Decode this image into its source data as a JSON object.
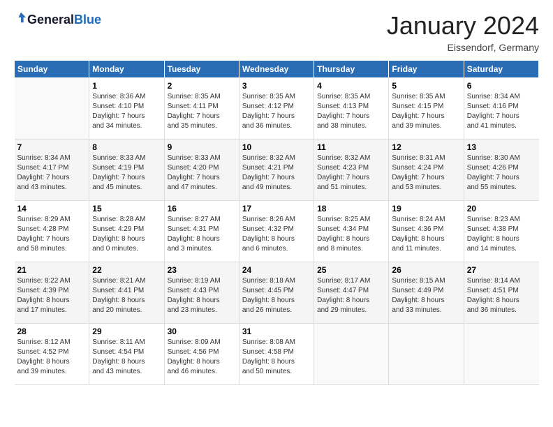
{
  "header": {
    "logo": {
      "general": "General",
      "blue": "Blue"
    },
    "title": "January 2024",
    "location": "Eissendorf, Germany"
  },
  "weekdays": [
    "Sunday",
    "Monday",
    "Tuesday",
    "Wednesday",
    "Thursday",
    "Friday",
    "Saturday"
  ],
  "weeks": [
    [
      {
        "day": "",
        "info": ""
      },
      {
        "day": "1",
        "info": "Sunrise: 8:36 AM\nSunset: 4:10 PM\nDaylight: 7 hours\nand 34 minutes."
      },
      {
        "day": "2",
        "info": "Sunrise: 8:35 AM\nSunset: 4:11 PM\nDaylight: 7 hours\nand 35 minutes."
      },
      {
        "day": "3",
        "info": "Sunrise: 8:35 AM\nSunset: 4:12 PM\nDaylight: 7 hours\nand 36 minutes."
      },
      {
        "day": "4",
        "info": "Sunrise: 8:35 AM\nSunset: 4:13 PM\nDaylight: 7 hours\nand 38 minutes."
      },
      {
        "day": "5",
        "info": "Sunrise: 8:35 AM\nSunset: 4:15 PM\nDaylight: 7 hours\nand 39 minutes."
      },
      {
        "day": "6",
        "info": "Sunrise: 8:34 AM\nSunset: 4:16 PM\nDaylight: 7 hours\nand 41 minutes."
      }
    ],
    [
      {
        "day": "7",
        "info": "Sunrise: 8:34 AM\nSunset: 4:17 PM\nDaylight: 7 hours\nand 43 minutes."
      },
      {
        "day": "8",
        "info": "Sunrise: 8:33 AM\nSunset: 4:19 PM\nDaylight: 7 hours\nand 45 minutes."
      },
      {
        "day": "9",
        "info": "Sunrise: 8:33 AM\nSunset: 4:20 PM\nDaylight: 7 hours\nand 47 minutes."
      },
      {
        "day": "10",
        "info": "Sunrise: 8:32 AM\nSunset: 4:21 PM\nDaylight: 7 hours\nand 49 minutes."
      },
      {
        "day": "11",
        "info": "Sunrise: 8:32 AM\nSunset: 4:23 PM\nDaylight: 7 hours\nand 51 minutes."
      },
      {
        "day": "12",
        "info": "Sunrise: 8:31 AM\nSunset: 4:24 PM\nDaylight: 7 hours\nand 53 minutes."
      },
      {
        "day": "13",
        "info": "Sunrise: 8:30 AM\nSunset: 4:26 PM\nDaylight: 7 hours\nand 55 minutes."
      }
    ],
    [
      {
        "day": "14",
        "info": "Sunrise: 8:29 AM\nSunset: 4:28 PM\nDaylight: 7 hours\nand 58 minutes."
      },
      {
        "day": "15",
        "info": "Sunrise: 8:28 AM\nSunset: 4:29 PM\nDaylight: 8 hours\nand 0 minutes."
      },
      {
        "day": "16",
        "info": "Sunrise: 8:27 AM\nSunset: 4:31 PM\nDaylight: 8 hours\nand 3 minutes."
      },
      {
        "day": "17",
        "info": "Sunrise: 8:26 AM\nSunset: 4:32 PM\nDaylight: 8 hours\nand 6 minutes."
      },
      {
        "day": "18",
        "info": "Sunrise: 8:25 AM\nSunset: 4:34 PM\nDaylight: 8 hours\nand 8 minutes."
      },
      {
        "day": "19",
        "info": "Sunrise: 8:24 AM\nSunset: 4:36 PM\nDaylight: 8 hours\nand 11 minutes."
      },
      {
        "day": "20",
        "info": "Sunrise: 8:23 AM\nSunset: 4:38 PM\nDaylight: 8 hours\nand 14 minutes."
      }
    ],
    [
      {
        "day": "21",
        "info": "Sunrise: 8:22 AM\nSunset: 4:39 PM\nDaylight: 8 hours\nand 17 minutes."
      },
      {
        "day": "22",
        "info": "Sunrise: 8:21 AM\nSunset: 4:41 PM\nDaylight: 8 hours\nand 20 minutes."
      },
      {
        "day": "23",
        "info": "Sunrise: 8:19 AM\nSunset: 4:43 PM\nDaylight: 8 hours\nand 23 minutes."
      },
      {
        "day": "24",
        "info": "Sunrise: 8:18 AM\nSunset: 4:45 PM\nDaylight: 8 hours\nand 26 minutes."
      },
      {
        "day": "25",
        "info": "Sunrise: 8:17 AM\nSunset: 4:47 PM\nDaylight: 8 hours\nand 29 minutes."
      },
      {
        "day": "26",
        "info": "Sunrise: 8:15 AM\nSunset: 4:49 PM\nDaylight: 8 hours\nand 33 minutes."
      },
      {
        "day": "27",
        "info": "Sunrise: 8:14 AM\nSunset: 4:51 PM\nDaylight: 8 hours\nand 36 minutes."
      }
    ],
    [
      {
        "day": "28",
        "info": "Sunrise: 8:12 AM\nSunset: 4:52 PM\nDaylight: 8 hours\nand 39 minutes."
      },
      {
        "day": "29",
        "info": "Sunrise: 8:11 AM\nSunset: 4:54 PM\nDaylight: 8 hours\nand 43 minutes."
      },
      {
        "day": "30",
        "info": "Sunrise: 8:09 AM\nSunset: 4:56 PM\nDaylight: 8 hours\nand 46 minutes."
      },
      {
        "day": "31",
        "info": "Sunrise: 8:08 AM\nSunset: 4:58 PM\nDaylight: 8 hours\nand 50 minutes."
      },
      {
        "day": "",
        "info": ""
      },
      {
        "day": "",
        "info": ""
      },
      {
        "day": "",
        "info": ""
      }
    ]
  ]
}
